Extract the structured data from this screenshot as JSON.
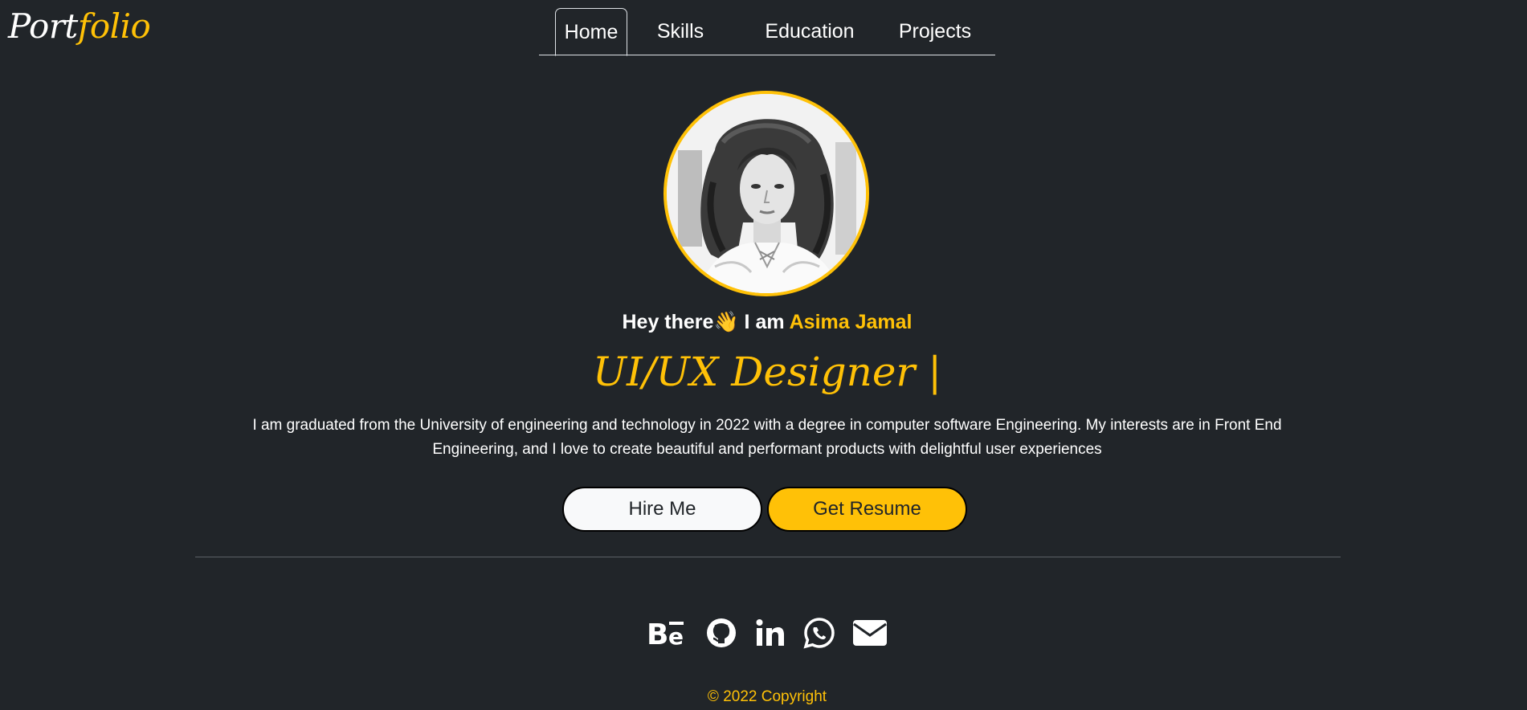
{
  "logo": {
    "part1": "Port",
    "part2": "folio"
  },
  "nav": {
    "tabs": [
      {
        "label": "Home",
        "active": true
      },
      {
        "label": "Skills",
        "active": false
      },
      {
        "label": "Education",
        "active": false
      },
      {
        "label": "Projects",
        "active": false
      }
    ]
  },
  "hero": {
    "greeting": "Hey there",
    "wave": "👋",
    "i_am": "I am",
    "name": "Asima Jamal",
    "role": "UI/UX Designer |",
    "bio": "I am graduated from the University of engineering and technology in 2022 with a degree in computer software Engineering. My interests are in Front End Engineering, and I love to create beautiful and performant products with delightful user experiences"
  },
  "buttons": {
    "hire": "Hire Me",
    "resume": "Get Resume"
  },
  "social": {
    "icons": [
      "behance-icon",
      "github-icon",
      "linkedin-icon",
      "whatsapp-icon",
      "envelope-icon"
    ]
  },
  "footer": {
    "copyright": "© 2022 Copyright"
  },
  "colors": {
    "background": "#212529",
    "accent": "#ffc107",
    "text": "#ffffff"
  }
}
